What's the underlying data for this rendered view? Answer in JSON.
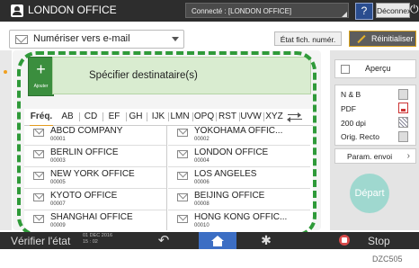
{
  "header": {
    "office_title": "LONDON OFFICE",
    "connection": "Connecté : [LONDON OFFICE]",
    "help_label": "?",
    "logout_label": "Déconnexion"
  },
  "toolbar": {
    "scan_mode": "Numériser vers e-mail",
    "status_label": "État fich. numér.",
    "reset_label": "Réinitialiser"
  },
  "destination": {
    "add_label": "Ajouter",
    "title": "Spécifier destinataire(s)"
  },
  "tabs": [
    "Fréq.",
    "AB",
    "CD",
    "EF",
    "GH",
    "IJK",
    "LMN",
    "OPQ",
    "RST",
    "UVW",
    "XYZ"
  ],
  "active_tab": "Fréq.",
  "entries": [
    {
      "name": "ABCD COMPANY",
      "number": "00001"
    },
    {
      "name": "YOKOHAMA OFFIC...",
      "number": "00002"
    },
    {
      "name": "BERLIN OFFICE",
      "number": "00003"
    },
    {
      "name": "LONDON OFFICE",
      "number": "00004"
    },
    {
      "name": "NEW YORK OFFICE",
      "number": "00005"
    },
    {
      "name": "LOS ANGELES",
      "number": "00006"
    },
    {
      "name": "KYOTO OFFICE",
      "number": "00007"
    },
    {
      "name": "BEIJING OFFICE",
      "number": "00008"
    },
    {
      "name": "SHANGHAI OFFICE",
      "number": "00009"
    },
    {
      "name": "HONG KONG OFFIC...",
      "number": "00010"
    }
  ],
  "side_panel": {
    "preview_label": "Aperçu",
    "settings": [
      "N & B",
      "PDF",
      "200 dpi",
      "Orig. Recto"
    ],
    "send_params_label": "Param. envoi",
    "start_label": "Départ"
  },
  "footer": {
    "check_status_label": "Vérifier l'état",
    "date": "01 DEC 2016",
    "time": "15 : 02",
    "stop_label": "Stop"
  },
  "figure_code": "DZC505",
  "colors": {
    "add_button": "#3b8e3e",
    "highlight_dashed": "#2f9a39",
    "active_tab_underline": "#e39b1e",
    "home_button": "#3c6ec4",
    "start_button": "#9fd8cf",
    "stop_icon": "#d94a4a"
  }
}
